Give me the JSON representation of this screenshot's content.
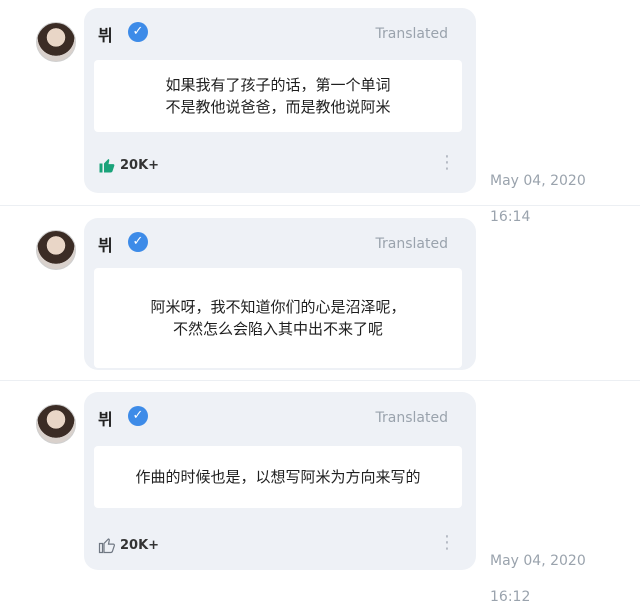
{
  "posts": [
    {
      "name": "뷔",
      "translated": "Translated",
      "message": "如果我有了孩子的话，第一个单词\n不是教他说爸爸，而是教他说阿米",
      "likes": "20K+",
      "date": "May 04, 2020",
      "time": "16:14"
    },
    {
      "name": "뷔",
      "translated": "Translated",
      "message": "阿米呀，我不知道你们的心是沼泽呢，\n不然怎么会陷入其中出不来了呢"
    },
    {
      "name": "뷔",
      "translated": "Translated",
      "message": "作曲的时候也是，以想写阿米为方向来写的",
      "likes": "20K+",
      "date": "May 04, 2020",
      "time": "16:12"
    }
  ]
}
